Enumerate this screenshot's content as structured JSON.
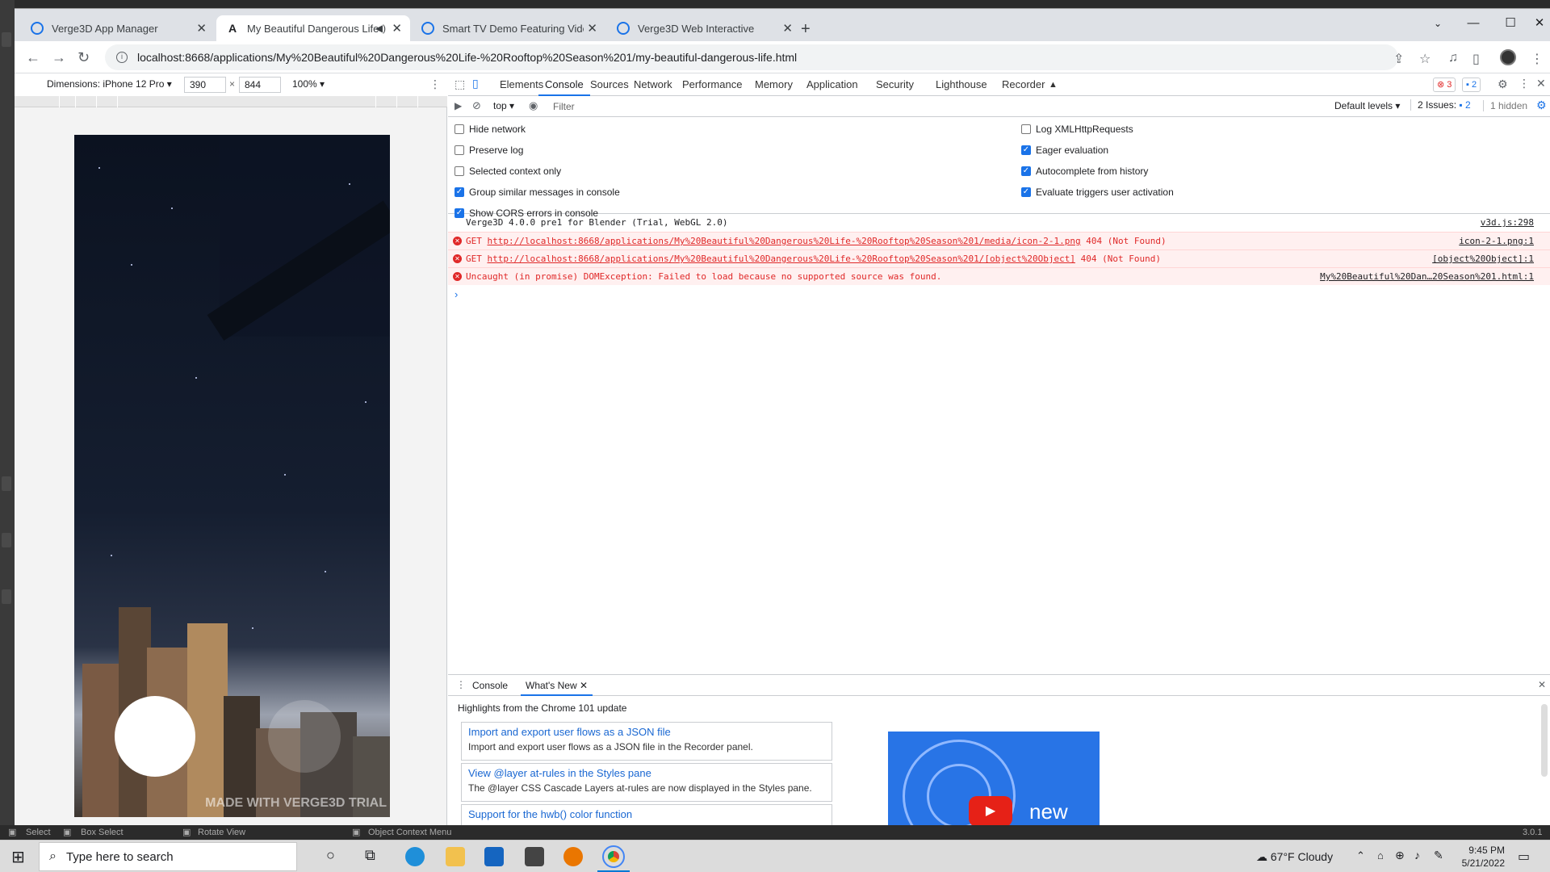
{
  "browser": {
    "tabs": [
      {
        "title": "Verge3D App Manager",
        "active": false,
        "icon": "verge3d-icon"
      },
      {
        "title": "My Beautiful Dangerous Life",
        "active": true,
        "icon": "verge3d-a-icon",
        "muted_indicator": "speaker-icon"
      },
      {
        "title": "Smart TV Demo Featuring Video",
        "active": false,
        "icon": "verge3d-icon"
      },
      {
        "title": "Verge3D Web Interactive",
        "active": false,
        "icon": "verge3d-icon"
      }
    ],
    "url": "localhost:8668/applications/My%20Beautiful%20Dangerous%20Life-%20Rooftop%20Season%201/my-beautiful-dangerous-life.html",
    "window_controls": [
      "minimize",
      "maximize",
      "close"
    ]
  },
  "device_toolbar": {
    "dimensions_label": "Dimensions: iPhone 12 Pro",
    "width": "390",
    "height": "844",
    "zoom": "100%"
  },
  "viewport": {
    "watermark": "MADE WITH VERGE3D TRIAL"
  },
  "devtools": {
    "tabs": [
      "Elements",
      "Console",
      "Sources",
      "Network",
      "Performance",
      "Memory",
      "Application",
      "Security",
      "Lighthouse",
      "Recorder"
    ],
    "active_tab": "Console",
    "error_count": "3",
    "message_count": "2",
    "console_toolbar": {
      "context": "top",
      "filter_placeholder": "Filter",
      "levels": "Default levels",
      "issues": "2 Issues:",
      "issues_count": "2",
      "hidden": "1 hidden"
    },
    "settings_left": [
      {
        "label": "Hide network",
        "checked": false
      },
      {
        "label": "Preserve log",
        "checked": false
      },
      {
        "label": "Selected context only",
        "checked": false
      },
      {
        "label": "Group similar messages in console",
        "checked": true
      },
      {
        "label": "Show CORS errors in console",
        "checked": true
      }
    ],
    "settings_right": [
      {
        "label": "Log XMLHttpRequests",
        "checked": false
      },
      {
        "label": "Eager evaluation",
        "checked": true
      },
      {
        "label": "Autocomplete from history",
        "checked": true
      },
      {
        "label": "Evaluate triggers user activation",
        "checked": true
      }
    ],
    "messages": [
      {
        "type": "info",
        "text": "Verge3D 4.0.0 pre1 for Blender (Trial, WebGL 2.0)",
        "source": "v3d.js:298"
      },
      {
        "type": "error",
        "prefix": "GET ",
        "link": "http://localhost:8668/applications/My%20Beautiful%20Dangerous%20Life-%20Rooftop%20Season%201/media/icon-2-1.png",
        "suffix": " 404 (Not Found)",
        "source": "icon-2-1.png:1"
      },
      {
        "type": "error",
        "prefix": "GET ",
        "link": "http://localhost:8668/applications/My%20Beautiful%20Dangerous%20Life-%20Rooftop%20Season%201/[object%20Object]",
        "suffix": " 404 (Not Found)",
        "source": "[object%20Object]:1"
      },
      {
        "type": "error",
        "text": "Uncaught (in promise) DOMException: Failed to load because no supported source was found.",
        "source": "My%20Beautiful%20Dan…20Season%201.html:1"
      }
    ],
    "drawer": {
      "tabs": [
        "Console",
        "What's New"
      ],
      "active": "What's New",
      "highlights": "Highlights from the Chrome 101 update",
      "cards": [
        {
          "title": "Import and export user flows as a JSON file",
          "desc": "Import and export user flows as a JSON file in the Recorder panel."
        },
        {
          "title": "View @layer at-rules in the Styles pane",
          "desc": "The @layer CSS Cascade Layers at-rules are now displayed in the Styles pane."
        },
        {
          "title": "Support for the hwb() color function",
          "desc": ""
        }
      ],
      "video_text": "new"
    }
  },
  "blender_status": {
    "items": [
      "Select",
      "Box Select",
      "Rotate View",
      "Object Context Menu"
    ],
    "version": "3.0.1"
  },
  "taskbar": {
    "search_placeholder": "Type here to search",
    "weather_temp": "67°F",
    "weather_text": "Cloudy",
    "time": "9:45 PM",
    "date": "5/21/2022"
  }
}
